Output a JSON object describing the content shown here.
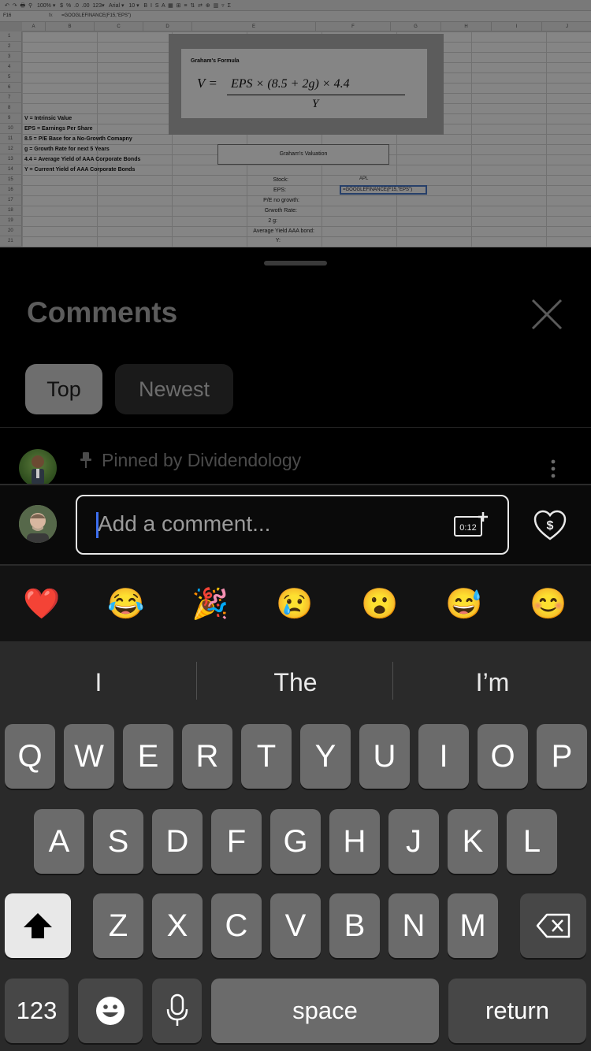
{
  "sheet": {
    "cell_ref": "F16",
    "formula": "=GOOGLEFINANCE(F15,\"EPS\")",
    "columns": [
      "A",
      "B",
      "C",
      "D",
      "E",
      "F",
      "G",
      "H",
      "I",
      "J"
    ],
    "rows": [
      "1",
      "2",
      "3",
      "4",
      "5",
      "6",
      "7",
      "8",
      "9",
      "10",
      "11",
      "12",
      "13",
      "14",
      "15",
      "16",
      "17",
      "18",
      "19",
      "20",
      "21"
    ],
    "image_title": "Graham's Formula",
    "formula_lhs": "V =",
    "formula_num": "EPS × (8.5 + 2g) × 4.4",
    "formula_den": "Y",
    "legend": [
      "V = Intrinsic Value",
      "EPS = Earnings Per Share",
      "8.5 = P/E Base for a No-Growth Comapny",
      "g = Growth Rate for next 5 Years",
      "4.4 = Average Yield of AAA Corporate Bonds",
      "Y = Current Yield of AAA Corporate Bonds"
    ],
    "valuation_box": "Graham's Valuation",
    "labels": [
      "Stock:",
      "EPS:",
      "P/E no growth:",
      "Grwoth Rate:",
      "2 g:",
      "Average Yield AAA bond:",
      "Y:"
    ],
    "stock_value": "APL",
    "active_cell": "=GOOGLEFINANCE(F15,\"EPS\")"
  },
  "comments": {
    "title": "Comments",
    "tabs": [
      {
        "label": "Top",
        "active": true
      },
      {
        "label": "Newest",
        "active": false
      }
    ],
    "pinned_text": "Pinned by Dividendology",
    "input_placeholder": "Add a comment...",
    "clip_icon_text": "0:12"
  },
  "emoji_bar": [
    "❤️",
    "😂",
    "🎉",
    "😢",
    "😮",
    "😅",
    "😊"
  ],
  "keyboard": {
    "suggestions": [
      "I",
      "The",
      "I’m"
    ],
    "row1": [
      "Q",
      "W",
      "E",
      "R",
      "T",
      "Y",
      "U",
      "I",
      "O",
      "P"
    ],
    "row2": [
      "A",
      "S",
      "D",
      "F",
      "G",
      "H",
      "J",
      "K",
      "L"
    ],
    "row3": [
      "Z",
      "X",
      "C",
      "V",
      "B",
      "N",
      "M"
    ],
    "numbers_label": "123",
    "space_label": "space",
    "return_label": "return"
  }
}
